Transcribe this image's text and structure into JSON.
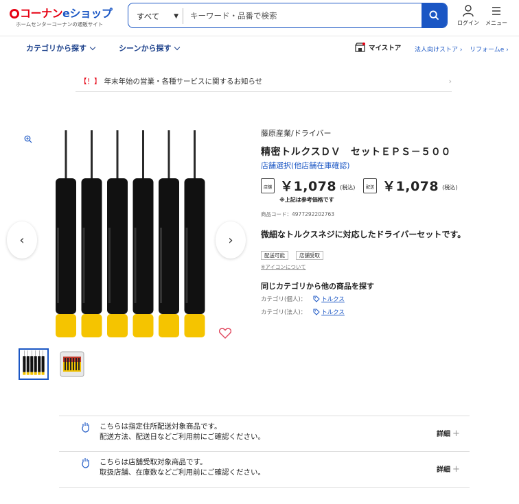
{
  "header": {
    "logo_text": "コーナン",
    "logo_e": "eショップ",
    "logo_sub": "ホームセンターコーナンの通販サイト",
    "search": {
      "category": "すべて",
      "placeholder": "キーワード・品番で検索"
    },
    "login_label": "ログイン",
    "menu_label": "メニュー"
  },
  "nav": {
    "category": "カテゴリから探す",
    "scene": "シーンから探す",
    "mystore": "マイストア",
    "corporate": "法人向けストア",
    "reform": "リフォームe"
  },
  "notice": {
    "mark": "【！】",
    "text": "年末年始の営業・各種サービスに関するお知らせ"
  },
  "product": {
    "brand": "藤原産業/ドライバー",
    "name": "精密トルクスＤＶ　セットＥＰＳ－５００",
    "store_select": "店舗選択(他店舗在庫確認)",
    "store_icon_label": "店舗",
    "delivery_icon_label": "配送",
    "price_store": "￥1,078",
    "price_delivery": "￥1,078",
    "tax_label": "(税込)",
    "ref_note": "※上記は参考価格です",
    "code": "商品コード：4977292202763",
    "description": "微細なトルクスネジに対応したドライバーセットです。",
    "tags": [
      "配送可能",
      "店舗受取"
    ],
    "icon_note": "※アイコンについて",
    "same_category_title": "同じカテゴリから他の商品を探す",
    "category_personal_label": "カテゴリ(個人)：",
    "category_personal_link": "トルクス",
    "category_corporate_label": "カテゴリ(法人)：",
    "category_corporate_link": "トルクス"
  },
  "delivery": [
    {
      "line1": "こちらは指定住所配送対象商品です。",
      "line2": "配送方法、配送日などご利用前にご確認ください。",
      "detail": "詳細"
    },
    {
      "line1": "こちらは店舗受取対象商品です。",
      "line2": "取扱店舗、在庫数などご利用前にご確認ください。",
      "detail": "詳細"
    }
  ],
  "colors": {
    "brand_red": "#e60012",
    "brand_blue": "#1a56c4",
    "handle_black": "#111111",
    "handle_yellow": "#f5c400"
  }
}
